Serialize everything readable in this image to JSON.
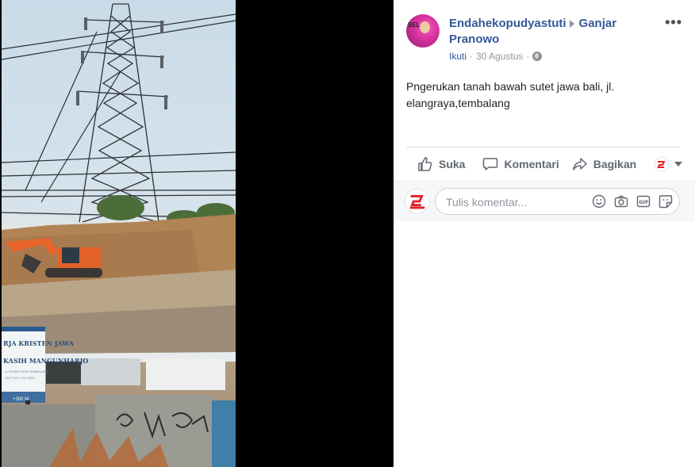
{
  "post": {
    "author": "Endahekopudyastuti",
    "target": "Ganjar Pranowo",
    "follow_label": "Ikuti",
    "date": "30 Agustus",
    "privacy_icon": "globe-icon",
    "text": "Pngerukan tanah bawah sutet jawa bali, jl. elangraya,tembalang",
    "more_label": "•••"
  },
  "actions": {
    "like_label": "Suka",
    "comment_label": "Komentari",
    "share_label": "Bagikan"
  },
  "comment": {
    "placeholder": "Tulis komentar..."
  },
  "colors": {
    "link": "#365899",
    "muted": "#90949c",
    "brand_red": "#e41e26"
  },
  "photo": {
    "description_icon": "photo-image"
  }
}
